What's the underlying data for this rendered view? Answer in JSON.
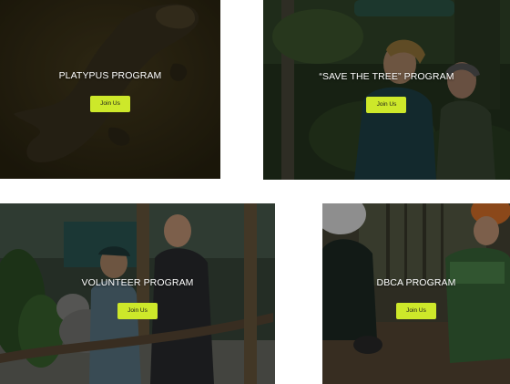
{
  "colors": {
    "button_bg": "#cde82a",
    "title_text": "#ffffff"
  },
  "programs": [
    {
      "title": "PLATYPUS PROGRAM",
      "button_label": "Join Us",
      "image_subject": "platypus-swimming"
    },
    {
      "title": "“SAVE THE TREE” PROGRAM",
      "button_label": "Join Us",
      "image_subject": "volunteers-planting-in-forest"
    },
    {
      "title": "VOLUNTEER PROGRAM",
      "button_label": "Join Us",
      "image_subject": "volunteers-with-koala"
    },
    {
      "title": "DBCA PROGRAM",
      "button_label": "Join Us",
      "image_subject": "dbca-volunteers-in-bushland"
    }
  ]
}
